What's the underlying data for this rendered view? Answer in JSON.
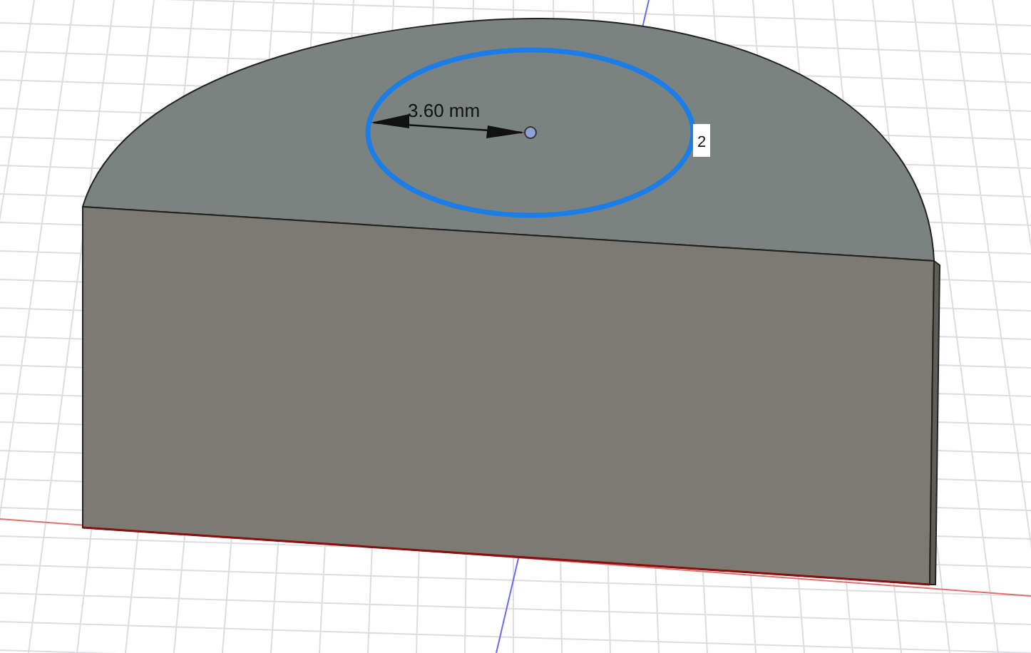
{
  "viewport": {
    "dimension": {
      "value": "3.60 mm"
    },
    "constraint_tag": "2"
  }
}
